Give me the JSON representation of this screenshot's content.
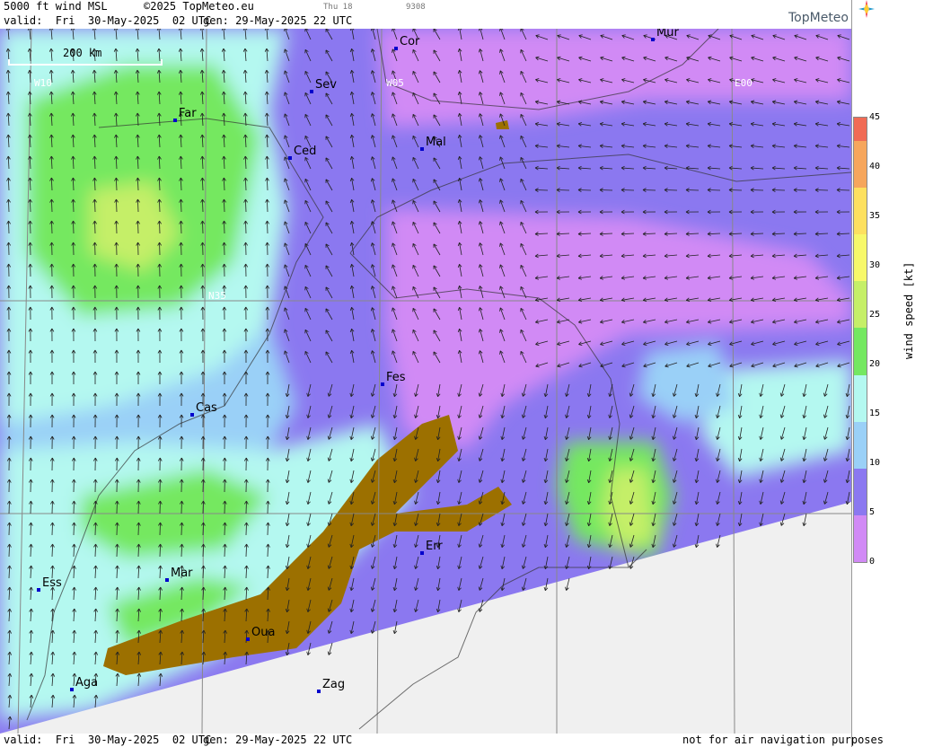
{
  "header": {
    "title": "5000 ft wind MSL",
    "copyright": "©2025 TopMeteo.eu",
    "valid": "valid:  Fri  30-May-2025  02 UTC",
    "gen": "gen: 29-May-2025 22 UTC",
    "day_small": "Thu 18",
    "code_small": "9308",
    "logo": "TopMeteo"
  },
  "footer": {
    "valid": "valid:  Fri  30-May-2025  02 UTC",
    "gen": "gen: 29-May-2025 22 UTC",
    "note": "not for air navigation purposes"
  },
  "map": {
    "scale_label": "200 km",
    "grid_labels": [
      "W10",
      "W05",
      "E00",
      "N35"
    ],
    "cities": [
      {
        "name": "Cor"
      },
      {
        "name": "Mur"
      },
      {
        "name": "Sev"
      },
      {
        "name": "Far"
      },
      {
        "name": "Ced"
      },
      {
        "name": "Mal"
      },
      {
        "name": "Fes"
      },
      {
        "name": "Cas"
      },
      {
        "name": "Err"
      },
      {
        "name": "Mar"
      },
      {
        "name": "Ess"
      },
      {
        "name": "Oua"
      },
      {
        "name": "Aga"
      },
      {
        "name": "Zag"
      }
    ]
  },
  "colorbar": {
    "label": "wind speed [kt]",
    "ticks": [
      "45",
      "40",
      "35",
      "30",
      "25",
      "20",
      "15",
      "10",
      "5",
      "0"
    ],
    "colors": [
      "#f06b55",
      "#f6a65c",
      "#fde05f",
      "#f7f86a",
      "#c5ef68",
      "#74e861",
      "#b4f8f0",
      "#9ad0f7",
      "#8b78f0",
      "#d18af5"
    ]
  }
}
